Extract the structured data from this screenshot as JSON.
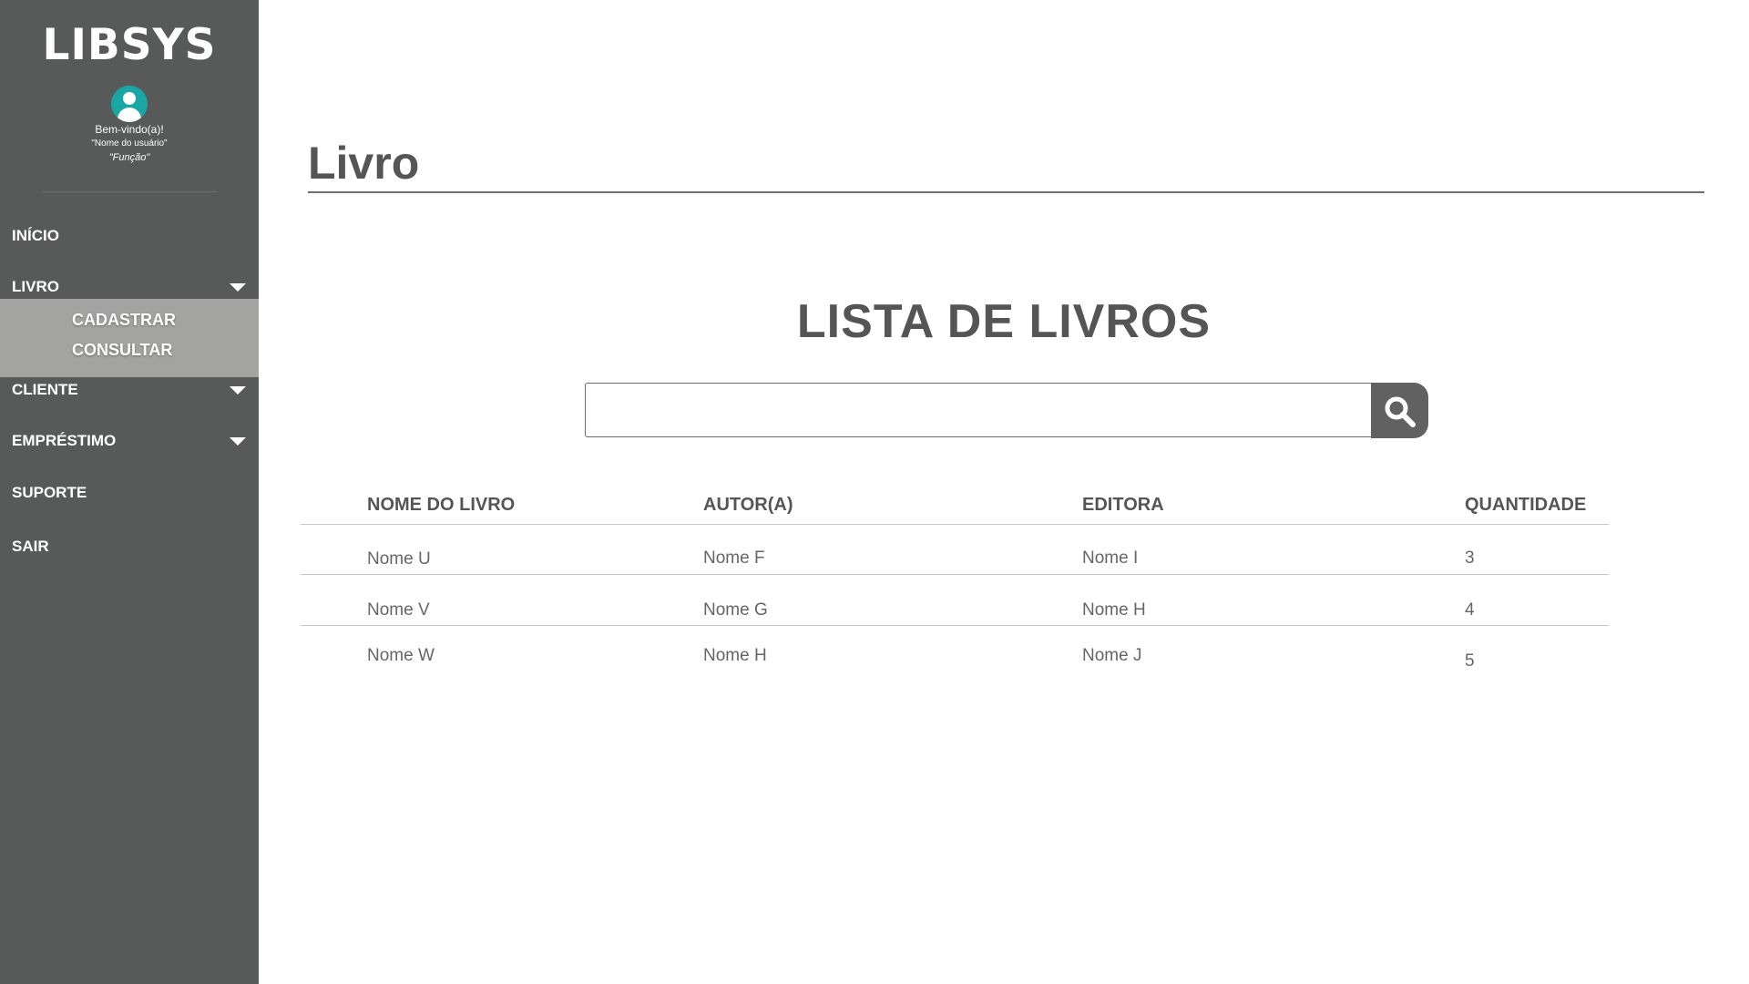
{
  "app": {
    "logo": "LIBSYS",
    "welcome": "Bem-vindo(a)!",
    "username": "\"Nome do usuário\"",
    "role": "\"Função\""
  },
  "sidebar": {
    "items": [
      {
        "label": "INÍCIO",
        "icon": ""
      },
      {
        "label": "LIVRO",
        "icon": "chevron-down-icon"
      },
      {
        "label": "CLIENTE",
        "icon": "chevron-down-icon"
      },
      {
        "label": "EMPRÉSTIMO",
        "icon": "chevron-down-icon"
      },
      {
        "label": "SUPORTE",
        "icon": ""
      },
      {
        "label": "SAIR",
        "icon": ""
      }
    ],
    "submenu": [
      "CADASTRAR",
      "CONSULTAR"
    ]
  },
  "page": {
    "title": "Livro",
    "heading": "LISTA DE LIVROS"
  },
  "search": {
    "value": "",
    "placeholder": ""
  },
  "table": {
    "headers": [
      "NOME DO LIVRO",
      "AUTOR(A)",
      "EDITORA",
      "QUANTIDADE"
    ],
    "rows": [
      [
        "Nome U",
        "Nome F",
        "Nome I",
        "3"
      ],
      [
        "Nome V",
        "Nome G",
        "Nome H",
        "4"
      ],
      [
        "Nome W",
        "Nome H",
        "Nome J",
        "5"
      ]
    ]
  },
  "colors": {
    "sidebar": "#585a59",
    "submenu": "#a3a3a2",
    "avatar": "#1ba6a6",
    "text_dark": "#555555",
    "search_button": "#616161"
  }
}
